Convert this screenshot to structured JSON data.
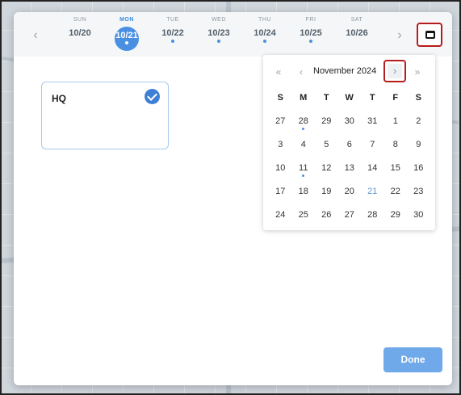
{
  "week_strip": {
    "prev_label": "‹",
    "next_label": "›",
    "days": [
      {
        "name": "SUN",
        "date": "10/20",
        "dot": false,
        "selected": false
      },
      {
        "name": "MON",
        "date": "10/21",
        "dot": true,
        "selected": true
      },
      {
        "name": "TUE",
        "date": "10/22",
        "dot": true,
        "selected": false
      },
      {
        "name": "WED",
        "date": "10/23",
        "dot": true,
        "selected": false
      },
      {
        "name": "THU",
        "date": "10/24",
        "dot": true,
        "selected": false
      },
      {
        "name": "FRI",
        "date": "10/25",
        "dot": true,
        "selected": false
      },
      {
        "name": "SAT",
        "date": "10/26",
        "dot": false,
        "selected": false
      }
    ]
  },
  "calendar_toggle_icon": "calendar-icon",
  "location": {
    "name": "HQ",
    "checked": true
  },
  "calendar": {
    "month_label": "November 2024",
    "prev_year_label": "«",
    "prev_month_label": "‹",
    "next_month_label": "›",
    "next_year_label": "»",
    "weekday_headers": [
      "S",
      "M",
      "T",
      "W",
      "T",
      "F",
      "S"
    ],
    "weeks": [
      [
        "27",
        "28",
        "29",
        "30",
        "31",
        "1",
        "2"
      ],
      [
        "3",
        "4",
        "5",
        "6",
        "7",
        "8",
        "9"
      ],
      [
        "10",
        "11",
        "12",
        "13",
        "14",
        "15",
        "16"
      ],
      [
        "17",
        "18",
        "19",
        "20",
        "21",
        "22",
        "23"
      ],
      [
        "24",
        "25",
        "26",
        "27",
        "28",
        "29",
        "30"
      ]
    ],
    "dotted_days": [
      "28",
      "11"
    ],
    "highlighted_day": "21"
  },
  "done_label": "Done",
  "colors": {
    "accent": "#4a90e2",
    "highlight_border": "#b71c1c"
  }
}
